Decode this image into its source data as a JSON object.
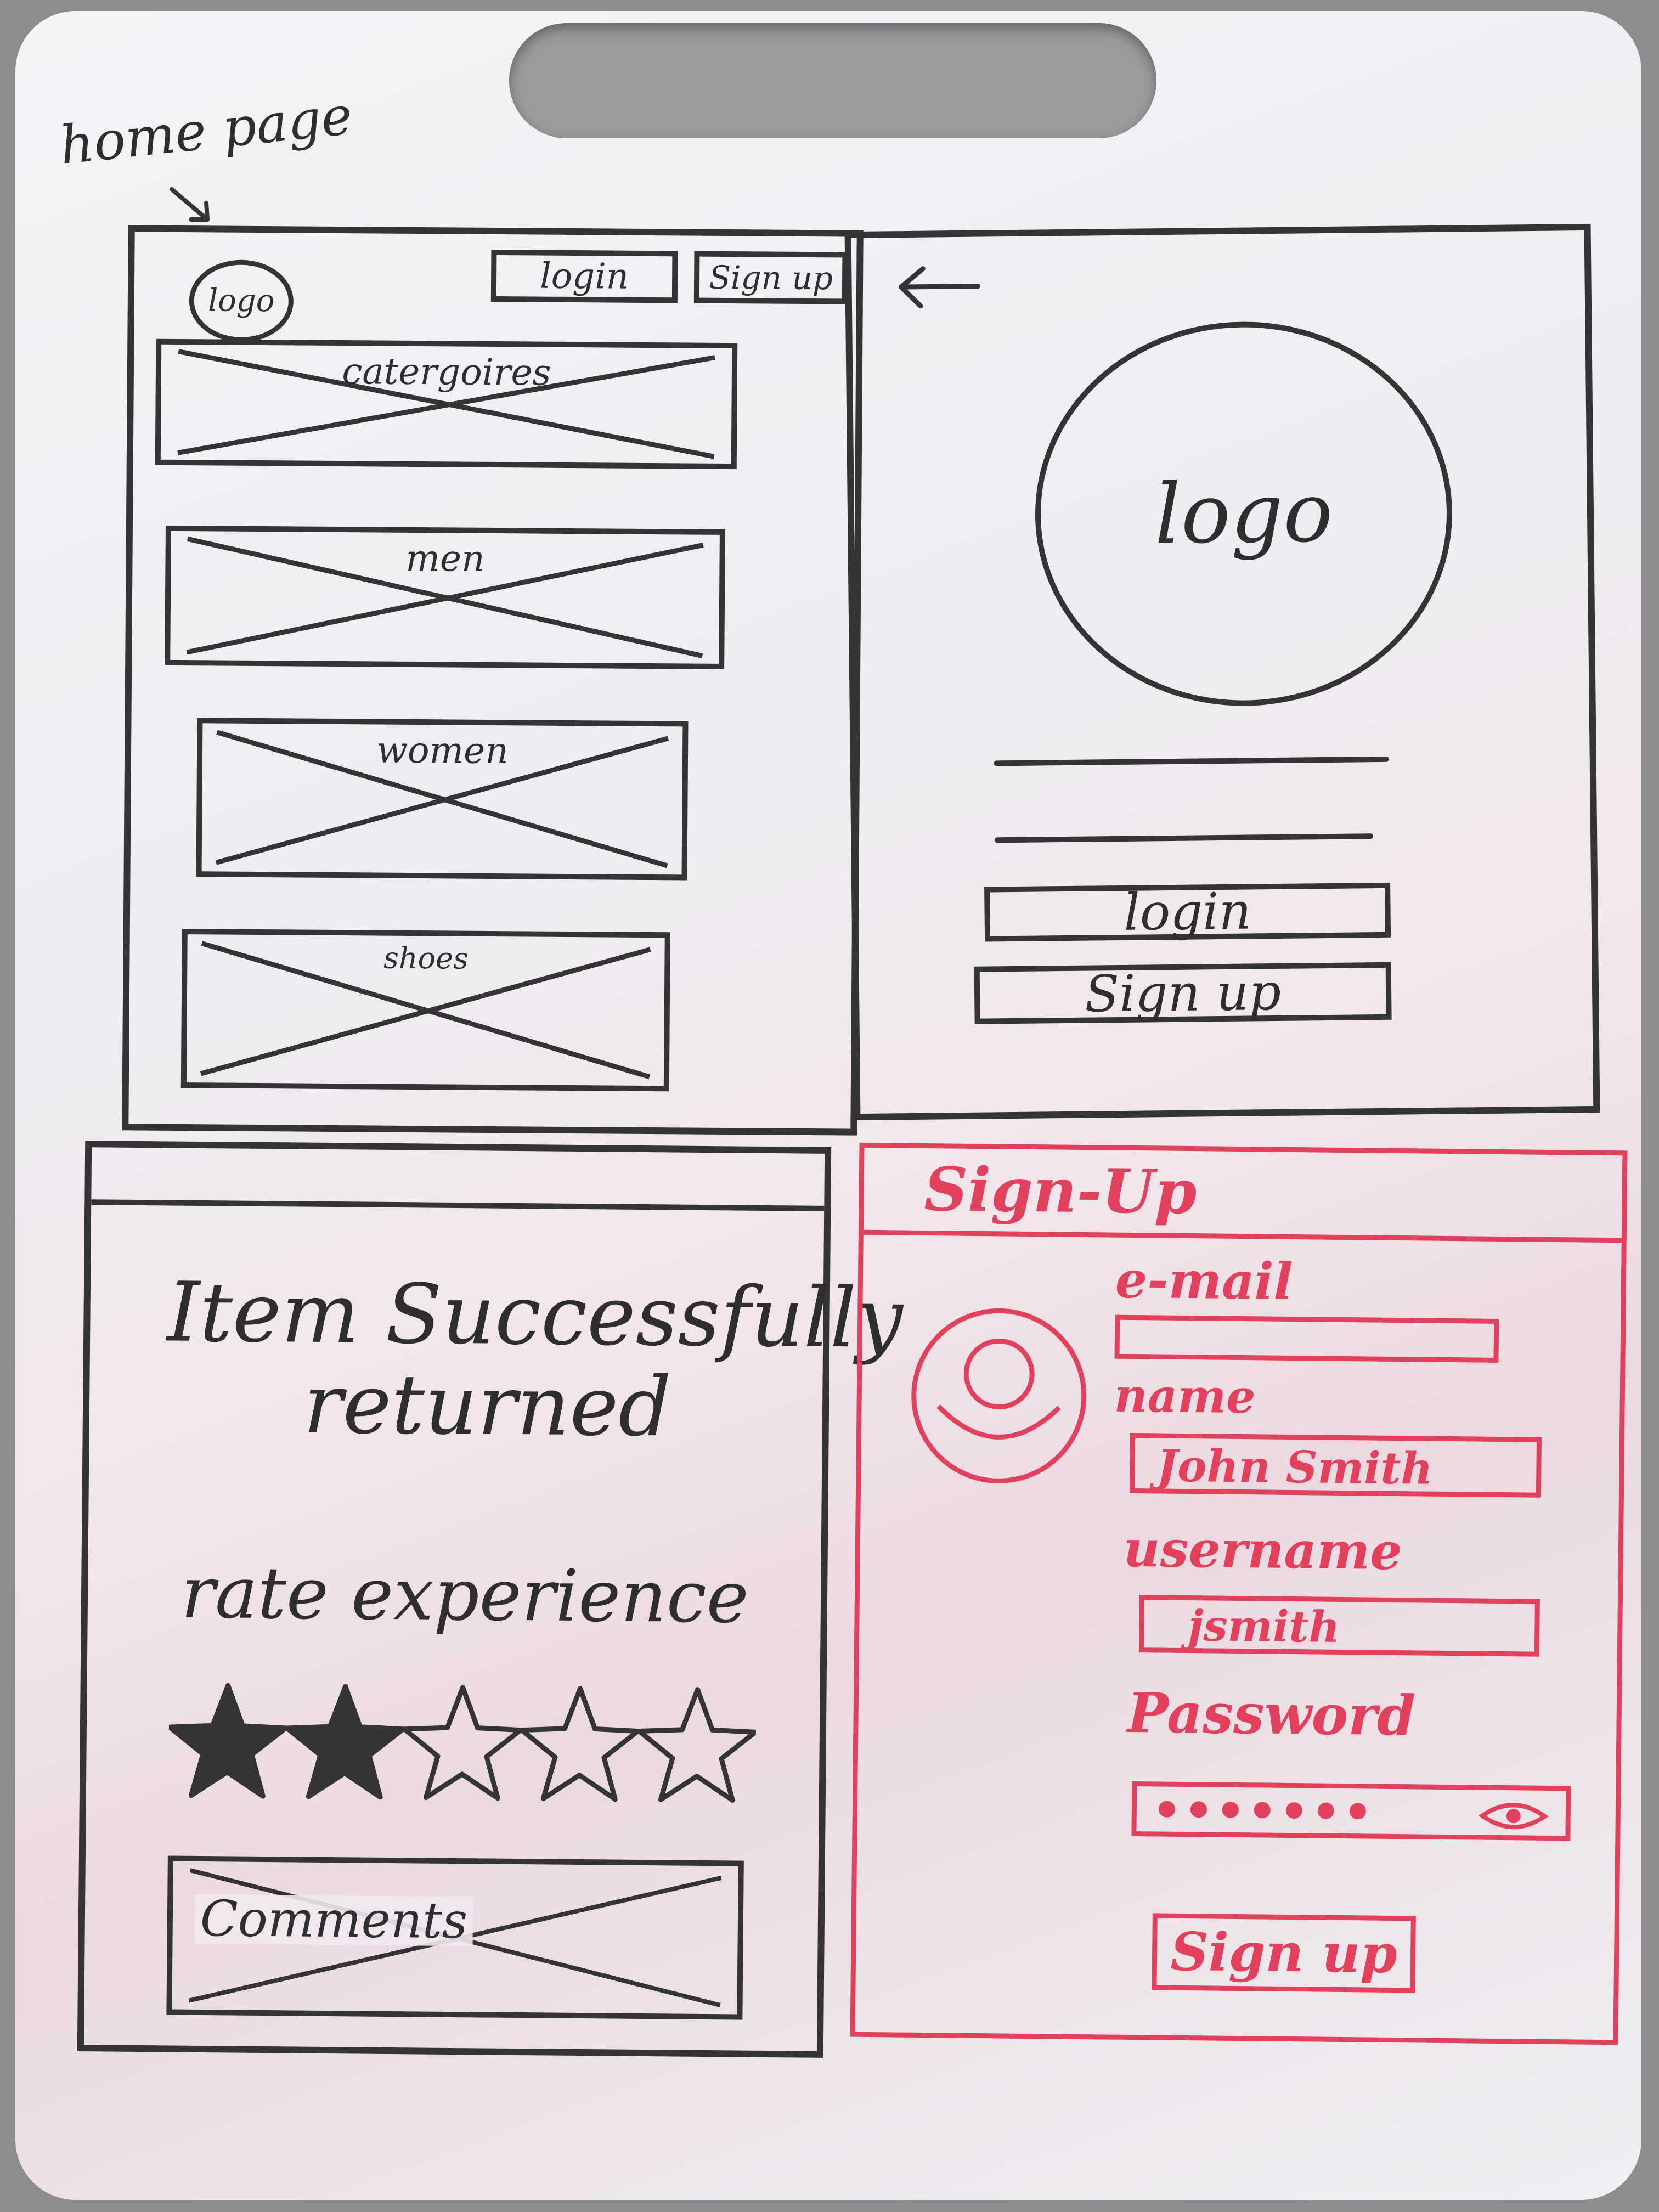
{
  "annotation": {
    "text": "home page"
  },
  "home": {
    "logo": "logo",
    "login_button": "login",
    "signup_button": "Sign up",
    "sections": [
      {
        "label": "catergoires"
      },
      {
        "label": "men"
      },
      {
        "label": "women"
      },
      {
        "label": "shoes"
      }
    ]
  },
  "login": {
    "logo": "logo",
    "login_button": "login",
    "signup_button": "Sign up"
  },
  "returned": {
    "message_line1": "Item Successfully",
    "message_line2": "returned",
    "rate_label": "rate experience",
    "rating": {
      "filled": 2,
      "total": 5
    },
    "comments_label": "Comments"
  },
  "signup": {
    "title": "Sign-Up",
    "email_label": "e-mail",
    "email_value": "",
    "name_label": "name",
    "name_value": "John Smith",
    "username_label": "username",
    "username_value": "jsmith",
    "password_label": "Password",
    "submit_button": "Sign up"
  },
  "colors": {
    "ink": "#343434",
    "red_marker": "#e1415c",
    "board": "#f2f1f4"
  },
  "icons": [
    "back-arrow-icon",
    "avatar-icon",
    "eye-icon",
    "star-icon"
  ]
}
